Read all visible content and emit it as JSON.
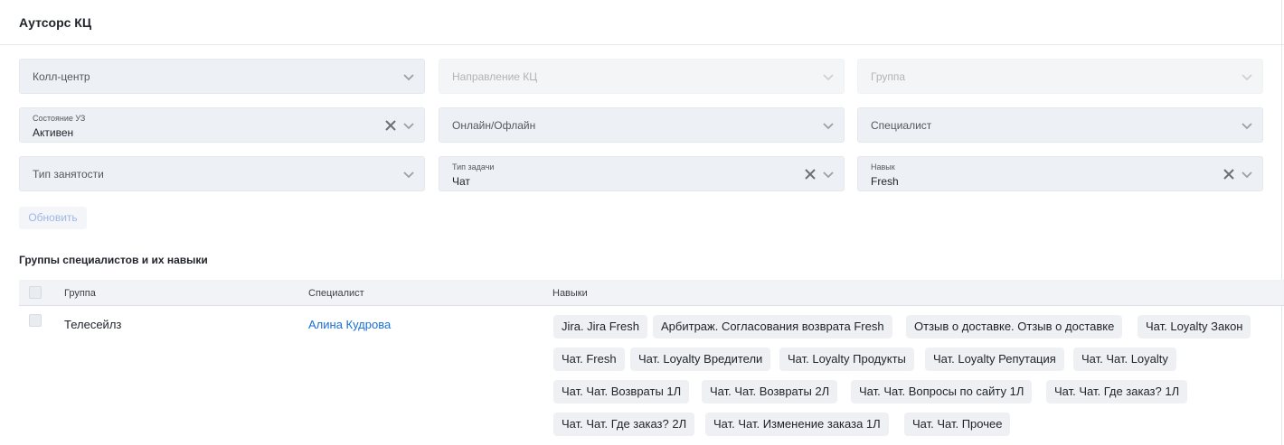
{
  "page": {
    "title": "Аутсорс КЦ"
  },
  "filters": {
    "call_center": {
      "placeholder": "Колл-центр"
    },
    "direction": {
      "placeholder": "Направление КЦ"
    },
    "group": {
      "placeholder": "Группа"
    },
    "state": {
      "label": "Состояние УЗ",
      "value": "Активен"
    },
    "online": {
      "placeholder": "Онлайн/Офлайн"
    },
    "specialist": {
      "placeholder": "Специалист"
    },
    "employment": {
      "placeholder": "Тип занятости"
    },
    "task_type": {
      "label": "Тип задачи",
      "value": "Чат"
    },
    "skill": {
      "label": "Навык",
      "value": "Fresh"
    }
  },
  "refresh_button": {
    "label": "Обновить"
  },
  "section": {
    "title": "Группы специалистов и их навыки"
  },
  "table": {
    "columns": [
      "Группа",
      "Специалист",
      "Навыки"
    ],
    "rows": [
      {
        "group": "Телесейлз",
        "specialist": "Алина Кудрова",
        "skills": [
          "Jira. Jira Fresh",
          "Арбитраж. Согласования возврата Fresh",
          "Отзыв о доставке. Отзыв о доставке",
          "Чат. Loyalty Закон",
          "Чат. Fresh",
          "Чат. Loyalty Вредители",
          "Чат. Loyalty Продукты",
          "Чат. Loyalty Репутация",
          "Чат. Чат. Loyalty",
          "Чат. Чат. Возвраты 1Л",
          "Чат. Чат. Возвраты 2Л",
          "Чат. Чат. Вопросы по сайту 1Л",
          "Чат. Чат. Где заказ? 1Л",
          "Чат. Чат. Где заказ? 2Л",
          "Чат. Чат. Изменение заказа 1Л",
          "Чат. Чат. Прочее"
        ]
      }
    ]
  },
  "icons": {
    "dropdown": "chevron-down-icon",
    "clear": "close-icon"
  },
  "colors": {
    "link": "#1a6fd6",
    "field_bg": "#edf0f4",
    "button_text": "#9fb6e8"
  }
}
